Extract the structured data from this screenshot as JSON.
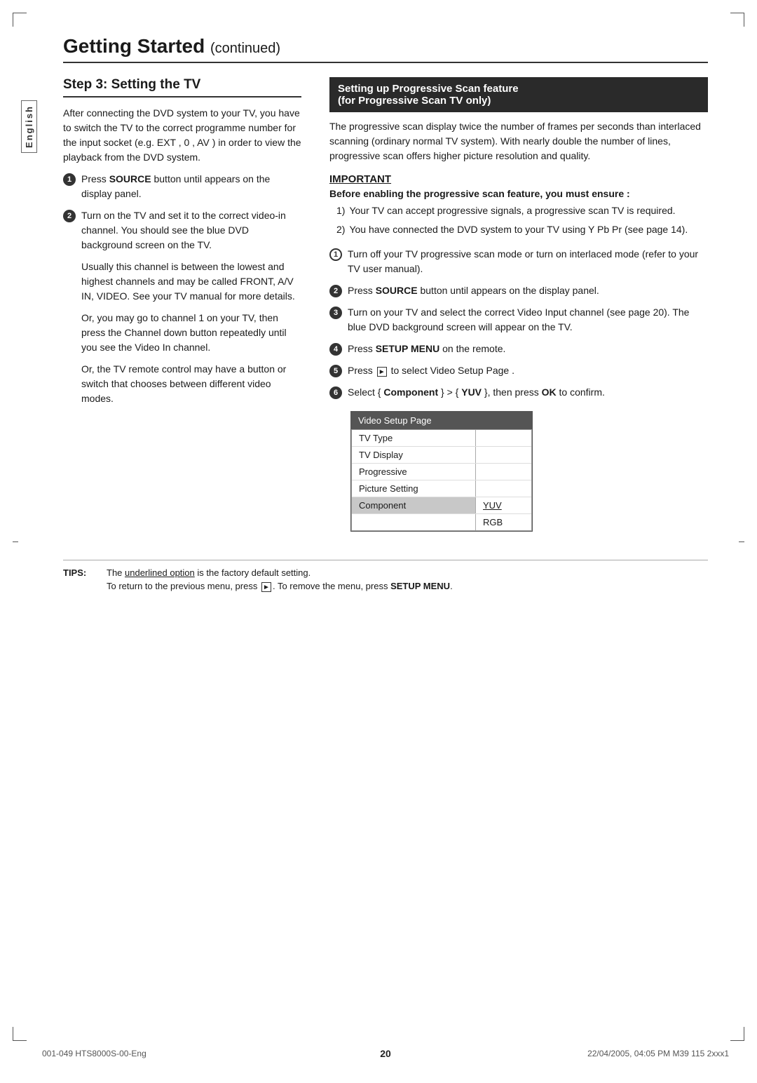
{
  "page": {
    "title": "Getting Started",
    "title_continued": "continued",
    "sidebar_label": "English",
    "page_number": "20"
  },
  "left_col": {
    "step_heading": "Step 3:  Setting the TV",
    "intro_text": "After connecting the DVD system to your TV, you have to switch the TV to the correct programme number for the input socket (e.g. EXT , 0 , AV ) in order to view the playback from the DVD system.",
    "items": [
      {
        "num": "1",
        "text_before": "Press ",
        "bold": "SOURCE",
        "text_after": " button until appears on the display panel."
      },
      {
        "num": "2",
        "text": "Turn on the TV and set it to the correct video-in channel. You should see the blue DVD background screen on the TV."
      }
    ],
    "paragraphs": [
      "Usually this channel is between the lowest and highest channels and may be called FRONT, A/V IN, VIDEO. See your TV manual for more details.",
      "Or, you may go to channel 1 on your TV, then press the Channel down button repeatedly until you see the Video In channel.",
      "Or, the TV remote control may have a button or switch that chooses between different video modes."
    ]
  },
  "right_col": {
    "section_heading_line1": "Setting up Progressive Scan feature",
    "section_heading_line2": "(for Progressive Scan TV only)",
    "intro_text": "The progressive scan display twice the number of frames per seconds than interlaced scanning (ordinary normal TV system). With nearly double the number of lines, progressive scan offers higher picture resolution and quality.",
    "important": {
      "title": "IMPORTANT",
      "subtitle": "Before enabling the progressive scan feature, you must ensure :",
      "sub_items": [
        "Your TV can accept progressive signals, a progressive scan TV is required.",
        "You have connected the DVD system to your TV using Y Pb Pr (see page 14)."
      ]
    },
    "steps": [
      {
        "num": "1",
        "type": "outline",
        "text": "Turn off your TV progressive scan mode or turn on interlaced mode (refer to your TV user manual)."
      },
      {
        "num": "2",
        "text_before": "Press ",
        "bold": "SOURCE",
        "text_after": " button until appears on the display panel."
      },
      {
        "num": "3",
        "text": "Turn on your TV and select the correct Video Input channel (see page 20). The blue DVD background screen will appear on the TV."
      },
      {
        "num": "4",
        "text_before": "Press ",
        "bold": "SETUP MENU",
        "text_after": " on the remote."
      },
      {
        "num": "5",
        "text_before": "Press",
        "arrow": true,
        "text_after": "to select  Video Setup Page ."
      },
      {
        "num": "6",
        "text_before": "Select { ",
        "bold1": "Component",
        "text_mid": " } > { ",
        "bold2": "YUV",
        "text_end": " }, then press ",
        "bold3": "OK",
        "text_final": " to confirm."
      }
    ],
    "video_setup_table": {
      "header": "Video Setup Page",
      "rows": [
        {
          "left": "TV Type",
          "right": "",
          "highlighted": false
        },
        {
          "left": "TV Display",
          "right": "",
          "highlighted": false
        },
        {
          "left": "Progressive",
          "right": "",
          "highlighted": false
        },
        {
          "left": "Picture Setting",
          "right": "",
          "highlighted": false
        },
        {
          "left": "Component",
          "right": "YUV",
          "highlighted": true,
          "right_underline": true
        },
        {
          "left": "",
          "right": "RGB",
          "highlighted": false
        }
      ]
    }
  },
  "tips": {
    "label": "TIPS:",
    "line1_before": "The ",
    "line1_underline": "underlined option",
    "line1_after": " is the factory default setting.",
    "line2_before": "To return to the previous menu, press",
    "line2_after": ". To remove the menu, press ",
    "line2_bold": "SETUP MENU",
    "line2_end": "."
  },
  "footer": {
    "left": "001-049 HTS8000S-00-Eng",
    "center": "20",
    "right_date": "22/04/2005, 04:05 PM",
    "right_model": "39 115 2xxx1"
  }
}
